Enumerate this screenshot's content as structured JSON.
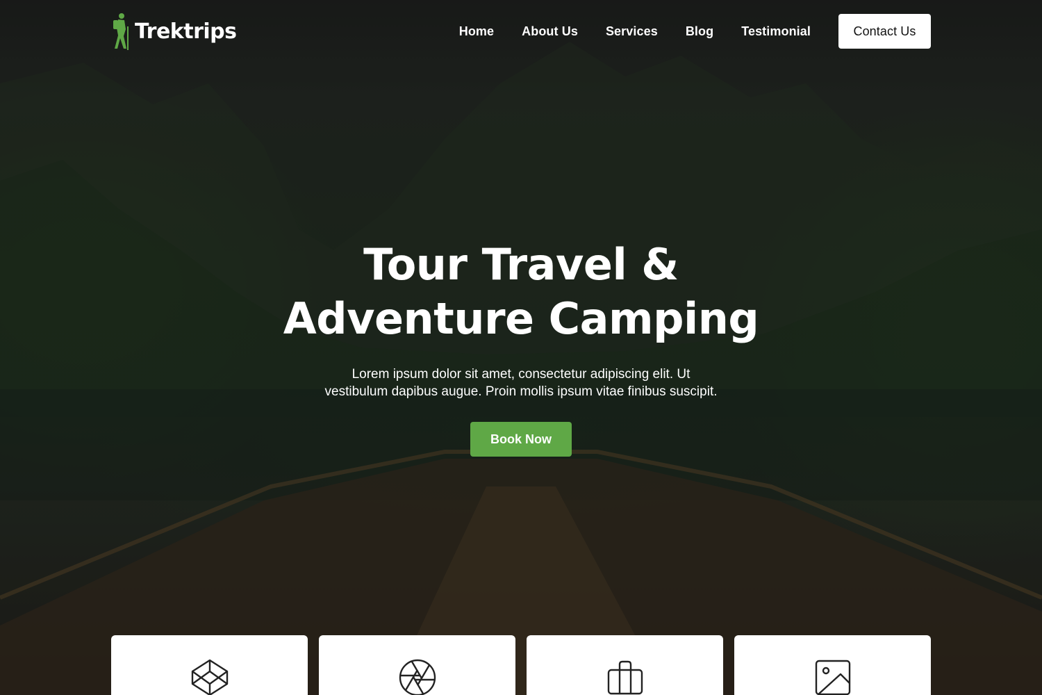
{
  "brand": {
    "name": "Trektrips",
    "logo_icon": "hiker-icon",
    "accent_color": "#5fa846"
  },
  "nav": {
    "items": [
      "Home",
      "About Us",
      "Services",
      "Blog",
      "Testimonial"
    ],
    "contact_label": "Contact Us"
  },
  "hero": {
    "title_line1": "Tour Travel &",
    "title_line2": "Adventure Camping",
    "description_line1": "Lorem ipsum dolor sit amet, consectetur adipiscing elit. Ut",
    "description_line2": "vestibulum dapibus augue. Proin mollis ipsum vitae finibus suscipit.",
    "cta_label": "Book Now"
  },
  "features": {
    "cards": [
      {
        "icon": "codepen-icon"
      },
      {
        "icon": "aperture-icon"
      },
      {
        "icon": "briefcase-icon"
      },
      {
        "icon": "image-icon"
      }
    ]
  }
}
